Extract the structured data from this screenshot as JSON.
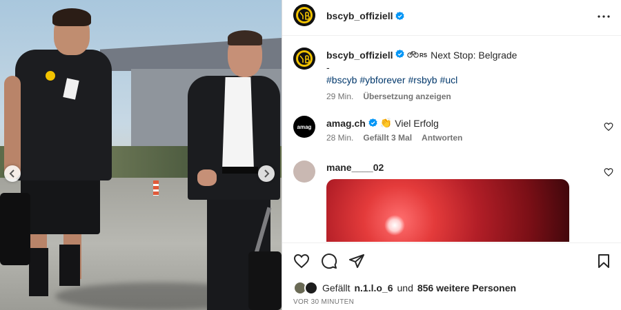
{
  "post": {
    "username": "bscyb_offiziell",
    "caption_text": "Next Stop: Belgrade",
    "caption_icon": "bike-rs-emoji",
    "caption_dash": "-",
    "hashtags": [
      "#bscyb",
      "#ybforever",
      "#rsbyb",
      "#ucl"
    ],
    "time": "29 Min.",
    "translate_label": "Übersetzung anzeigen"
  },
  "comments": [
    {
      "username": "amag.ch",
      "avatar_text": "amag",
      "text": "Viel Erfolg",
      "emoji": "👏",
      "time": "28 Min.",
      "likes": "Gefällt 3 Mal",
      "reply_label": "Antworten"
    },
    {
      "username": "mane____02",
      "text": ""
    }
  ],
  "likes": {
    "prefix": "Gefällt",
    "first_user": "n.1.l.o_6",
    "connector": "und",
    "others": "856 weitere Personen"
  },
  "timestamp": "VOR 30 MINUTEN",
  "colors": {
    "verified": "#0095f6",
    "hashtag": "#00376b",
    "crest_yellow": "#f2c300"
  }
}
